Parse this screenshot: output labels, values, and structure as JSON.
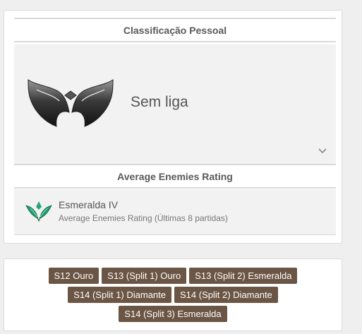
{
  "solo": {
    "title": "Classificação Pessoal",
    "rank": "Sem liga",
    "emblem_icon": "unranked-emblem-icon",
    "expand_icon": "chevron-down-icon"
  },
  "average": {
    "title": "Average Enemies Rating",
    "rank": "Esmeralda IV",
    "subtitle": "Average Enemies Rating (Últimas 8 partidas)",
    "icon": "emerald-emblem-icon",
    "icon_color": "#1f9d6e"
  },
  "seasons": {
    "row1": [
      "S12 Ouro",
      "S13 (Split 1) Ouro",
      "S13 (Split 2) Esmeralda"
    ],
    "row2": [
      "S14 (Split 1) Diamante",
      "S14 (Split 2) Diamante"
    ],
    "row3": [
      "S14 (Split 3) Esmeralda"
    ],
    "tag_color": "#6b5544"
  }
}
